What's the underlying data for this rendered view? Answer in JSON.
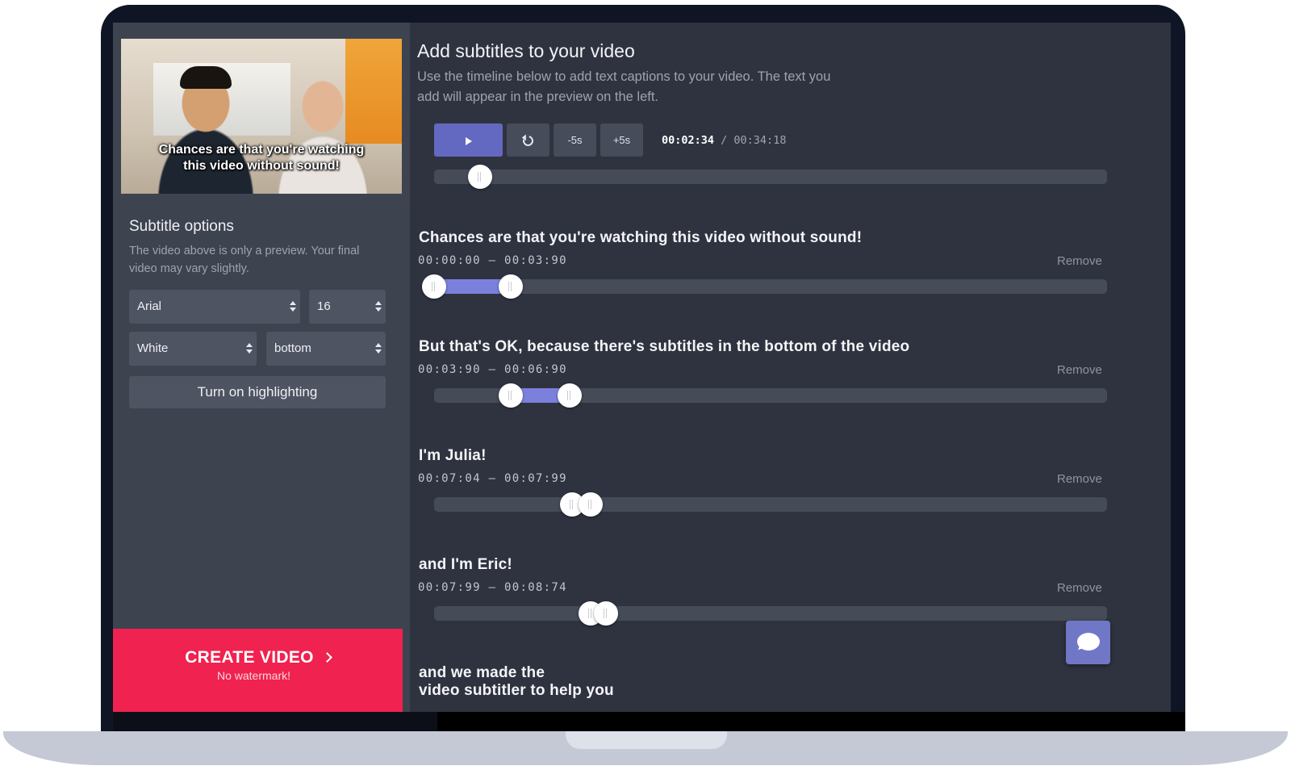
{
  "preview": {
    "caption_line1": "Chances are that you're watching",
    "caption_line2": "this video without sound!"
  },
  "options": {
    "title": "Subtitle options",
    "description": "The video above is only a preview. Your final video may vary slightly.",
    "font": "Arial",
    "size": "16",
    "color": "White",
    "position": "bottom",
    "highlight_label": "Turn on highlighting"
  },
  "create": {
    "label": "CREATE VIDEO",
    "sub": "No watermark!"
  },
  "main": {
    "title": "Add subtitles to your video",
    "description": "Use the timeline below to add text captions to your video. The text you add will appear in the preview on the left."
  },
  "player": {
    "back_label": "-5s",
    "forward_label": "+5s",
    "current_time": "00:02:34",
    "separator": " / ",
    "total_time": "00:34:18",
    "progress": 0.068
  },
  "subtitles": [
    {
      "text": "Chances are that you're watching this video without sound!",
      "range": "00:00:00 – 00:03:90",
      "remove": "Remove",
      "start": 0.0,
      "end": 0.114
    },
    {
      "text": "But that's OK, because there's subtitles in the bottom of the video",
      "range": "00:03:90 – 00:06:90",
      "remove": "Remove",
      "start": 0.114,
      "end": 0.201
    },
    {
      "text": "I'm Julia!",
      "range": "00:07:04 – 00:07:99",
      "remove": "Remove",
      "start": 0.205,
      "end": 0.233
    },
    {
      "text": "and I'm Eric!",
      "range": "00:07:99 – 00:08:74",
      "remove": "Remove",
      "start": 0.233,
      "end": 0.255
    },
    {
      "text_line1": "and we made the",
      "text_line2": "video subtitler to help you"
    }
  ],
  "icons": {
    "play": "play-icon",
    "replay": "replay-icon",
    "chat": "chat-icon",
    "chevron": "chevron-right-icon"
  },
  "colors": {
    "accent": "#6369c0",
    "range": "#7b80dc",
    "create": "#f0224f"
  }
}
